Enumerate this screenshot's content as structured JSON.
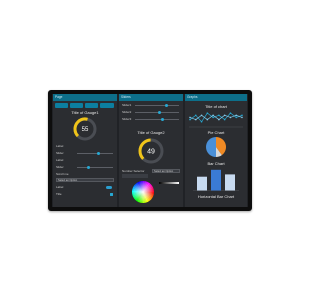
{
  "panel1": {
    "header": "Page",
    "gauge_title": "Title of Gauge1",
    "gauge_value": 55,
    "gauge_fraction": 0.55,
    "row_labels": [
      "Label",
      "Slider",
      "Label",
      "Slider",
      "Scroll me",
      "Select an Option",
      "Label",
      "Title"
    ]
  },
  "panel2": {
    "header": "Sliders",
    "slider_labels": [
      "Slider1",
      "Slider2",
      "Slider3"
    ],
    "slider_levels": [
      0.72,
      0.55,
      0.62
    ],
    "gauge_title": "Title of Gauge2",
    "gauge_value": 49,
    "gauge_fraction": 0.49,
    "select_left_label": "Number Selector",
    "select_right_label": "Select an Option"
  },
  "panel3": {
    "header": "Graphs",
    "line_title": "Title of chart",
    "pie_title": "Pie Chart",
    "bar_title": "Bar Chart",
    "hbar_title": "Horizontal Bar Chart"
  },
  "colors": {
    "accent": "#27a9d3",
    "gauge_yellow": "#f0c419",
    "gauge_green": "#8bc34a",
    "pie_orange": "#f08a24",
    "pie_blue": "#4a90d9",
    "bar_light": "#c7daf0",
    "bar_blue": "#3a7bd5"
  },
  "chart_data": [
    {
      "type": "line",
      "series": [
        {
          "values": [
            3,
            5,
            2,
            6,
            4,
            5,
            3,
            6,
            4,
            5
          ]
        },
        {
          "values": [
            4,
            3,
            5,
            3,
            5,
            3,
            5,
            4,
            5,
            4
          ]
        }
      ]
    },
    {
      "type": "pie",
      "values": [
        40,
        10,
        50
      ]
    },
    {
      "type": "bar",
      "values": [
        6,
        9,
        7
      ]
    }
  ]
}
